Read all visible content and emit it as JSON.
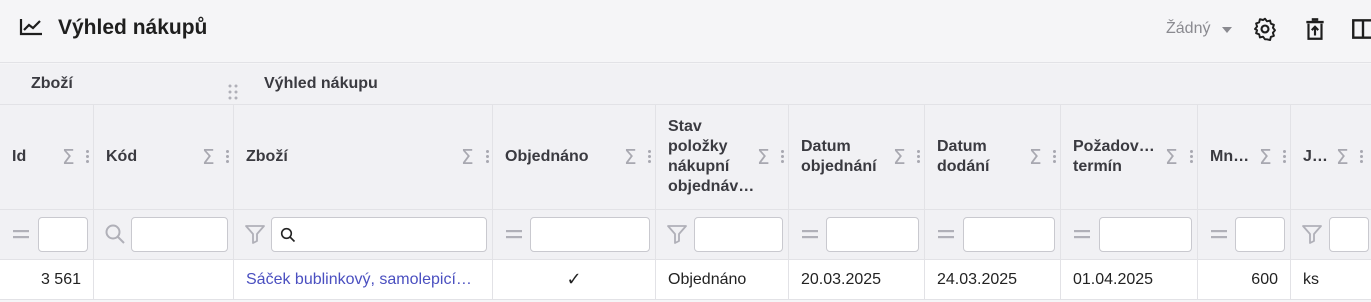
{
  "header": {
    "title": "Výhled nákupů",
    "view_select_value": "Žádný"
  },
  "groups": {
    "goods": "Zboží",
    "purchase_outlook": "Výhled nákupu"
  },
  "columns": [
    {
      "label": "Id"
    },
    {
      "label": "Kód"
    },
    {
      "label": "Zboží"
    },
    {
      "label": "Objednáno"
    },
    {
      "label": "Stav položky nákupní objednáv…"
    },
    {
      "label": "Datum objednání"
    },
    {
      "label": "Datum dodání"
    },
    {
      "label": "Požadov… termín"
    },
    {
      "label": "Mn…"
    },
    {
      "label": "J…"
    }
  ],
  "sigma_symbol": "Σ",
  "checkmark": "✓",
  "row": {
    "id": "3 561",
    "code": "",
    "goods": "Sáček bublinkový, samolepicí…",
    "ordered": "✓",
    "status": "Objednáno",
    "order_date": "20.03.2025",
    "delivery_date": "24.03.2025",
    "required_date": "01.04.2025",
    "quantity": "600",
    "unit": "ks"
  },
  "icons": {
    "title": "trending-up-icon",
    "settings": "gear-icon",
    "export": "trash-upload-icon",
    "columns": "columns-icon",
    "equals": "equals-icon",
    "search": "search-icon",
    "filter": "filter-icon"
  }
}
